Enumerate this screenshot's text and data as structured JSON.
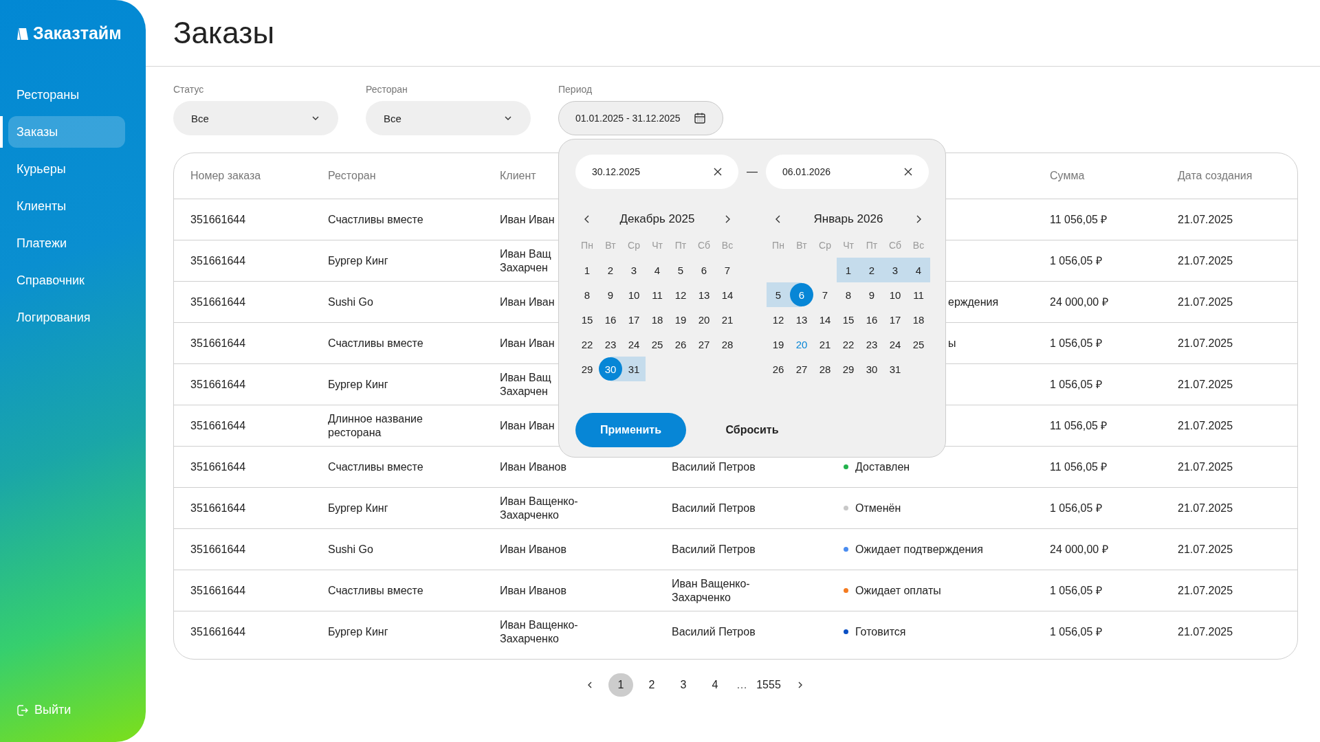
{
  "sidebar": {
    "logo": "Заказтайм",
    "items": [
      {
        "label": "Рестораны",
        "selected": false
      },
      {
        "label": "Заказы",
        "selected": true
      },
      {
        "label": "Курьеры",
        "selected": false
      },
      {
        "label": "Клиенты",
        "selected": false
      },
      {
        "label": "Платежи",
        "selected": false
      },
      {
        "label": "Справочник",
        "selected": false
      },
      {
        "label": "Логирования",
        "selected": false
      }
    ],
    "logout": "Выйти"
  },
  "page_title": "Заказы",
  "filters": [
    {
      "label": "Статус",
      "kind": "select",
      "value": "Все"
    },
    {
      "label": "Ресторан",
      "kind": "select",
      "value": "Все"
    },
    {
      "label": "Период",
      "kind": "date",
      "value": "01.01.2025 - 31.12.2025"
    }
  ],
  "table": {
    "columns": [
      "Номер заказа",
      "Ресторан",
      "Клиент",
      null,
      null,
      "Сумма",
      "Дата создания"
    ],
    "rows": [
      {
        "number": "351661644",
        "restaurant": "Счастливы вместе",
        "client": "Иван Иван",
        "sum": "11 056,05 ₽",
        "date": "21.07.2025"
      },
      {
        "number": "351661644",
        "restaurant": "Бургер Кинг",
        "client": "Иван Ващ\nЗахарчен",
        "sum": "1 056,05 ₽",
        "date": "21.07.2025"
      },
      {
        "number": "351661644",
        "restaurant": "Sushi Go",
        "client": "Иван Иван",
        "status": {
          "kind": "peek",
          "text": "ерждения"
        },
        "sum": "24 000,00 ₽",
        "date": "21.07.2025"
      },
      {
        "number": "351661644",
        "restaurant": "Счастливы вместе",
        "client": "Иван Иван",
        "status": {
          "kind": "peek",
          "text": "ы"
        },
        "sum": "1 056,05 ₽",
        "date": "21.07.2025"
      },
      {
        "number": "351661644",
        "restaurant": "Бургер Кинг",
        "client": "Иван Ващ\nЗахарчен",
        "sum": "1 056,05 ₽",
        "date": "21.07.2025"
      },
      {
        "number": "351661644",
        "restaurant": "Длинное название ресторана",
        "client": "Иван Иван",
        "sum": "11 056,05 ₽",
        "date": "21.07.2025"
      },
      {
        "number": "351661644",
        "restaurant": "Счастливы вместе",
        "client": "Иван Иванов",
        "courier": "Василий Петров",
        "status": {
          "kind": "dot",
          "text": "Доставлен",
          "color": "#22b24c"
        },
        "sum": "11 056,05 ₽",
        "date": "21.07.2025"
      },
      {
        "number": "351661644",
        "restaurant": "Бургер Кинг",
        "client": "Иван Ващенко-Захарченко",
        "courier": "Василий Петров",
        "status": {
          "kind": "dot",
          "text": "Отменён",
          "color": "#c8c8c8"
        },
        "sum": "1 056,05 ₽",
        "date": "21.07.2025"
      },
      {
        "number": "351661644",
        "restaurant": "Sushi Go",
        "client": "Иван Иванов",
        "courier": "Василий Петров",
        "status": {
          "kind": "dot",
          "text": "Ожидает подтверждения",
          "color": "#4a8cf0"
        },
        "sum": "24 000,00 ₽",
        "date": "21.07.2025"
      },
      {
        "number": "351661644",
        "restaurant": "Счастливы вместе",
        "client": "Иван Иванов",
        "courier": "Иван Ващенко-Захарченко",
        "status": {
          "kind": "dot",
          "text": "Ожидает оплаты",
          "color": "#f47b20"
        },
        "sum": "1 056,05 ₽",
        "date": "21.07.2025"
      },
      {
        "number": "351661644",
        "restaurant": "Бургер Кинг",
        "client": "Иван Ващенко-Захарченко",
        "courier": "Василий Петров",
        "status": {
          "kind": "dot",
          "text": "Готовится",
          "color": "#0a4fc4"
        },
        "sum": "1 056,05 ₽",
        "date": "21.07.2025"
      }
    ]
  },
  "date_picker": {
    "start": "30.12.2025",
    "end": "06.01.2026",
    "separator": "—",
    "months": [
      {
        "title": "Декабрь 2025",
        "weekdays": [
          "Пн",
          "Вт",
          "Ср",
          "Чт",
          "Пт",
          "Сб",
          "Вс"
        ],
        "weeks": [
          [
            {
              "d": "1",
              "selected": false,
              "in_range": false,
              "today": false
            },
            {
              "d": "2",
              "selected": false,
              "in_range": false,
              "today": false
            },
            {
              "d": "3",
              "selected": false,
              "in_range": false,
              "today": false
            },
            {
              "d": "4",
              "selected": false,
              "in_range": false,
              "today": false
            },
            {
              "d": "5",
              "selected": false,
              "in_range": false,
              "today": false
            },
            {
              "d": "6",
              "selected": false,
              "in_range": false,
              "today": false
            },
            {
              "d": "7",
              "selected": false,
              "in_range": false,
              "today": false
            }
          ],
          [
            {
              "d": "8",
              "selected": false,
              "in_range": false,
              "today": false
            },
            {
              "d": "9",
              "selected": false,
              "in_range": false,
              "today": false
            },
            {
              "d": "10",
              "selected": false,
              "in_range": false,
              "today": false
            },
            {
              "d": "11",
              "selected": false,
              "in_range": false,
              "today": false
            },
            {
              "d": "12",
              "selected": false,
              "in_range": false,
              "today": false
            },
            {
              "d": "13",
              "selected": false,
              "in_range": false,
              "today": false
            },
            {
              "d": "14",
              "selected": false,
              "in_range": false,
              "today": false
            }
          ],
          [
            {
              "d": "15",
              "selected": false,
              "in_range": false,
              "today": false
            },
            {
              "d": "16",
              "selected": false,
              "in_range": false,
              "today": false
            },
            {
              "d": "17",
              "selected": false,
              "in_range": false,
              "today": false
            },
            {
              "d": "18",
              "selected": false,
              "in_range": false,
              "today": false
            },
            {
              "d": "19",
              "selected": false,
              "in_range": false,
              "today": false
            },
            {
              "d": "20",
              "selected": false,
              "in_range": false,
              "today": false
            },
            {
              "d": "21",
              "selected": false,
              "in_range": false,
              "today": false
            }
          ],
          [
            {
              "d": "22",
              "selected": false,
              "in_range": false,
              "today": false
            },
            {
              "d": "23",
              "selected": false,
              "in_range": false,
              "today": false
            },
            {
              "d": "24",
              "selected": false,
              "in_range": false,
              "today": false
            },
            {
              "d": "25",
              "selected": false,
              "in_range": false,
              "today": false
            },
            {
              "d": "26",
              "selected": false,
              "in_range": false,
              "today": false
            },
            {
              "d": "27",
              "selected": false,
              "in_range": false,
              "today": false
            },
            {
              "d": "28",
              "selected": false,
              "in_range": false,
              "today": false
            }
          ],
          [
            {
              "d": "29",
              "selected": false,
              "in_range": false,
              "today": false
            },
            {
              "d": "30",
              "selected": true,
              "in_range": false,
              "today": false
            },
            {
              "d": "31",
              "selected": false,
              "in_range": true,
              "today": false
            }
          ]
        ]
      },
      {
        "title": "Январь 2026",
        "weekdays": [
          "Пн",
          "Вт",
          "Ср",
          "Чт",
          "Пт",
          "Сб",
          "Вс"
        ],
        "weeks": [
          [
            {
              "d": "1",
              "selected": false,
              "in_range": true,
              "today": false
            },
            {
              "d": "2",
              "selected": false,
              "in_range": true,
              "today": false
            },
            {
              "d": "3",
              "selected": false,
              "in_range": true,
              "today": false
            },
            {
              "d": "4",
              "selected": false,
              "in_range": true,
              "today": false
            }
          ],
          [
            {
              "d": "5",
              "selected": false,
              "in_range": true,
              "today": false
            },
            {
              "d": "6",
              "selected": true,
              "in_range": false,
              "today": false
            },
            {
              "d": "7",
              "selected": false,
              "in_range": false,
              "today": false
            },
            {
              "d": "8",
              "selected": false,
              "in_range": false,
              "today": false
            },
            {
              "d": "9",
              "selected": false,
              "in_range": false,
              "today": false
            },
            {
              "d": "10",
              "selected": false,
              "in_range": false,
              "today": false
            },
            {
              "d": "11",
              "selected": false,
              "in_range": false,
              "today": false
            }
          ],
          [
            {
              "d": "12",
              "selected": false,
              "in_range": false,
              "today": false
            },
            {
              "d": "13",
              "selected": false,
              "in_range": false,
              "today": false
            },
            {
              "d": "14",
              "selected": false,
              "in_range": false,
              "today": false
            },
            {
              "d": "15",
              "selected": false,
              "in_range": false,
              "today": false
            },
            {
              "d": "16",
              "selected": false,
              "in_range": false,
              "today": false
            },
            {
              "d": "17",
              "selected": false,
              "in_range": false,
              "today": false
            },
            {
              "d": "18",
              "selected": false,
              "in_range": false,
              "today": false
            }
          ],
          [
            {
              "d": "19",
              "selected": false,
              "in_range": false,
              "today": false
            },
            {
              "d": "20",
              "selected": false,
              "in_range": false,
              "today": true
            },
            {
              "d": "21",
              "selected": false,
              "in_range": false,
              "today": false
            },
            {
              "d": "22",
              "selected": false,
              "in_range": false,
              "today": false
            },
            {
              "d": "23",
              "selected": false,
              "in_range": false,
              "today": false
            },
            {
              "d": "24",
              "selected": false,
              "in_range": false,
              "today": false
            },
            {
              "d": "25",
              "selected": false,
              "in_range": false,
              "today": false
            }
          ],
          [
            {
              "d": "26",
              "selected": false,
              "in_range": false,
              "today": false
            },
            {
              "d": "27",
              "selected": false,
              "in_range": false,
              "today": false
            },
            {
              "d": "28",
              "selected": false,
              "in_range": false,
              "today": false
            },
            {
              "d": "29",
              "selected": false,
              "in_range": false,
              "today": false
            },
            {
              "d": "30",
              "selected": false,
              "in_range": false,
              "today": false
            },
            {
              "d": "31",
              "selected": false,
              "in_range": false,
              "today": false
            }
          ]
        ]
      }
    ],
    "apply": "Применить",
    "reset": "Сбросить"
  },
  "pagination": {
    "pages": [
      {
        "label": "1",
        "kind": "page",
        "selected": true
      },
      {
        "label": "2",
        "kind": "page",
        "selected": false
      },
      {
        "label": "3",
        "kind": "page",
        "selected": false
      },
      {
        "label": "4",
        "kind": "page",
        "selected": false
      },
      {
        "label": "…",
        "kind": "gap",
        "selected": false
      },
      {
        "label": "1555",
        "kind": "page",
        "selected": false
      }
    ]
  }
}
